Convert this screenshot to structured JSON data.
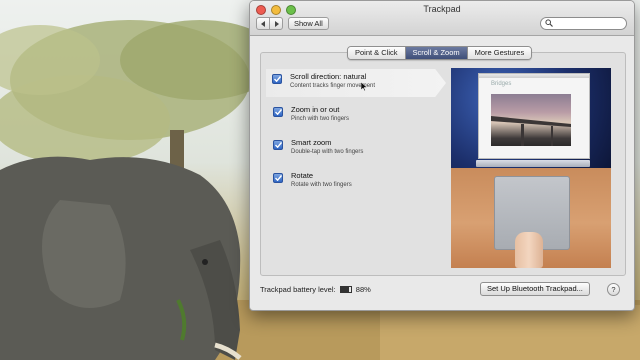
{
  "window": {
    "title": "Trackpad",
    "nav": {
      "back_icon": "chevron-left-icon",
      "forward_icon": "chevron-right-icon"
    },
    "show_all_label": "Show All",
    "search": {
      "value": "",
      "placeholder": ""
    }
  },
  "tabs": [
    {
      "label": "Point & Click",
      "active": false
    },
    {
      "label": "Scroll & Zoom",
      "active": true
    },
    {
      "label": "More Gestures",
      "active": false
    }
  ],
  "options": [
    {
      "title": "Scroll direction: natural",
      "description": "Content tracks finger movement",
      "checked": true,
      "highlighted": true
    },
    {
      "title": "Zoom in or out",
      "description": "Pinch with two fingers",
      "checked": true,
      "highlighted": false
    },
    {
      "title": "Smart zoom",
      "description": "Double-tap with two fingers",
      "checked": true,
      "highlighted": false
    },
    {
      "title": "Rotate",
      "description": "Rotate with two fingers",
      "checked": true,
      "highlighted": false
    }
  ],
  "preview": {
    "window_title": "Bridges"
  },
  "footer": {
    "battery_label": "Trackpad battery level:",
    "battery_value": "88%",
    "battery_fraction": 0.88,
    "setup_button_label": "Set Up Bluetooth Trackpad...",
    "help_label": "?"
  },
  "colors": {
    "accent_tab": "#3f4f79",
    "checkbox_blue": "#2f66c4"
  }
}
